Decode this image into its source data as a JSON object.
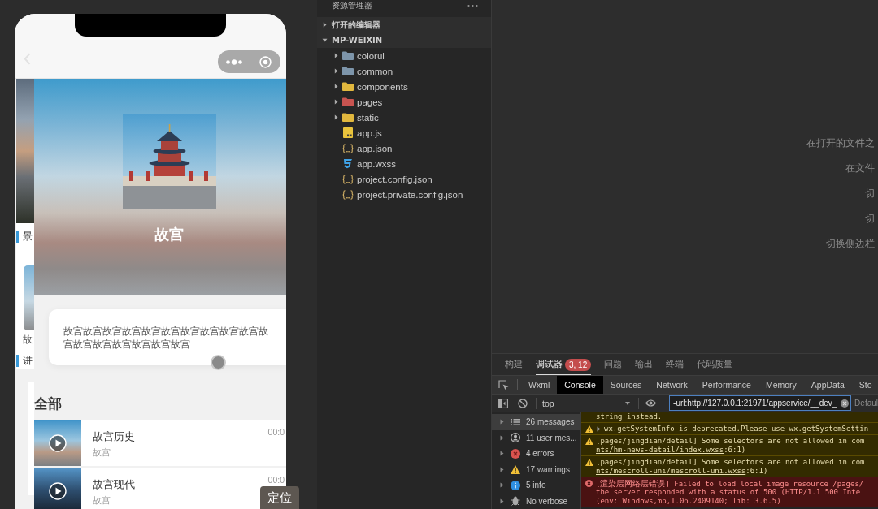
{
  "phone": {
    "side_preview": [
      {
        "kind": "photo"
      },
      {
        "kind": "tag",
        "text": "景"
      },
      {
        "kind": "card",
        "text": "故"
      },
      {
        "kind": "tag",
        "text": "讲"
      }
    ],
    "hero": {
      "title": "故宫"
    },
    "description": "故宫故宫故宫故宫故宫故宫故宫故宫故宫故宫故宫故宫故宫故宫故宫故宫故宫",
    "section_title": "全部",
    "tracks": [
      {
        "title": "故宫历史",
        "subtitle": "故宫",
        "duration": "00:0"
      },
      {
        "title": "故宫现代",
        "subtitle": "故宫",
        "duration": "00:0"
      }
    ],
    "locate_button": "定位"
  },
  "explorer": {
    "title": "资源管理器",
    "tree": [
      {
        "label": "打开的编辑器",
        "expanded": false
      },
      {
        "label": "MP-WEIXIN",
        "expanded": true,
        "children": [
          {
            "label": "colorui",
            "kind": "folder",
            "expanded": false,
            "color": "#7d95aa"
          },
          {
            "label": "common",
            "kind": "folder",
            "expanded": false,
            "color": "#7d95aa"
          },
          {
            "label": "components",
            "kind": "folder",
            "expanded": false,
            "color": "#e2b83e"
          },
          {
            "label": "pages",
            "kind": "folder",
            "expanded": false,
            "color": "#c85450"
          },
          {
            "label": "static",
            "kind": "folder",
            "expanded": false,
            "color": "#e2b83e"
          },
          {
            "label": "app.js",
            "kind": "js"
          },
          {
            "label": "app.json",
            "kind": "json"
          },
          {
            "label": "app.wxss",
            "kind": "css"
          },
          {
            "label": "project.config.json",
            "kind": "json"
          },
          {
            "label": "project.private.config.json",
            "kind": "json"
          }
        ]
      }
    ]
  },
  "editor_hints": [
    "在打开的文件之",
    "在文件",
    "切",
    "切",
    "切换侧边栏"
  ],
  "panel": {
    "tabs": [
      {
        "label": "构建",
        "selected": false
      },
      {
        "label": "调试器",
        "selected": true,
        "badge": "3, 12"
      },
      {
        "label": "问题",
        "selected": false
      },
      {
        "label": "输出",
        "selected": false
      },
      {
        "label": "终端",
        "selected": false
      },
      {
        "label": "代码质量",
        "selected": false
      }
    ]
  },
  "devtools": {
    "tabs": [
      {
        "label": "Wxml",
        "selected": false
      },
      {
        "label": "Console",
        "selected": true
      },
      {
        "label": "Sources",
        "selected": false
      },
      {
        "label": "Network",
        "selected": false
      },
      {
        "label": "Performance",
        "selected": false
      },
      {
        "label": "Memory",
        "selected": false
      },
      {
        "label": "AppData",
        "selected": false
      },
      {
        "label": "Sto",
        "selected": false
      }
    ],
    "toolbar": {
      "context": "top",
      "filter": "-url:http://127.0.0.1:21971/appservice/__dev_",
      "levels": "Defaul"
    },
    "sidebar": [
      {
        "label": "26 messages",
        "kind": "all",
        "selected": true
      },
      {
        "label": "11 user mes...",
        "kind": "user",
        "selected": false
      },
      {
        "label": "4 errors",
        "kind": "error",
        "selected": false
      },
      {
        "label": "17 warnings",
        "kind": "warning",
        "selected": false
      },
      {
        "label": "5 info",
        "kind": "info",
        "selected": false
      },
      {
        "label": "No verbose",
        "kind": "verbose",
        "selected": false
      }
    ],
    "messages": [
      {
        "kind": "warning",
        "show_icon": false,
        "expandable": false,
        "lines": [
          "string instead."
        ]
      },
      {
        "kind": "warning",
        "show_icon": true,
        "expandable": true,
        "lines": [
          "wx.getSystemInfo is deprecated.Please use wx.getSystemSettin"
        ]
      },
      {
        "kind": "warning",
        "show_icon": true,
        "expandable": false,
        "lines": [
          "[pages/jingdian/detail] Some selectors are not allowed in com"
        ],
        "link": {
          "text": "nts/hm-news-detail/index.wxss",
          "after": ":6:1)"
        }
      },
      {
        "kind": "warning",
        "show_icon": true,
        "expandable": false,
        "lines": [
          "[pages/jingdian/detail] Some selectors are not allowed in com"
        ],
        "link": {
          "text": "nts/mescroll-uni/mescroll-uni.wxss",
          "after": ":6:1)"
        }
      },
      {
        "kind": "error",
        "show_icon": true,
        "expandable": false,
        "lines": [
          "[渲染层网络层错误] Failed to load local image resource /pages/",
          "the server responded with a status of 500 (HTTP/1.1 500 Inte",
          "(env: Windows,mp,1.06.2409140; lib: 3.6.5)"
        ]
      }
    ]
  }
}
